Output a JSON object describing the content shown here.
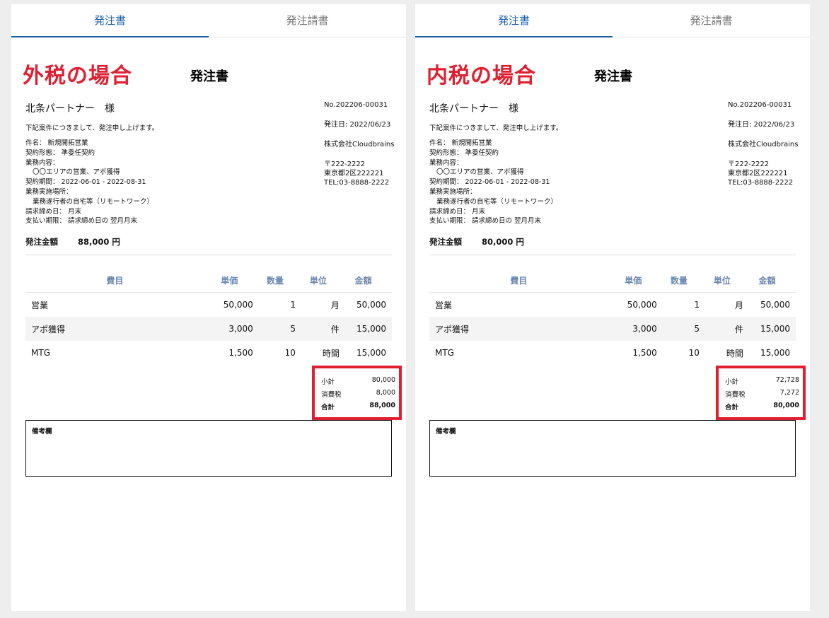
{
  "panels": [
    {
      "tabs": [
        {
          "label": "発注書",
          "active": true
        },
        {
          "label": "発注請書",
          "active": false
        }
      ],
      "tax_label": "外税の場合",
      "doc_title": "発注書",
      "client": "北条パートナー　様",
      "intro": "下記案件につきまして、発注申し上げます。",
      "details": [
        "件名： 新規開拓営業",
        "契約形態： 準委任契約",
        "業務内容：",
        "〇〇エリアの営業、アポ獲得",
        "契約期間： 2022-06-01 - 2022-08-31",
        "業務実施場所：",
        "業務遂行者の自宅等（リモートワーク）",
        "請求締め日： 月末",
        "支払い期限： 請求締め日の 翌月月末"
      ],
      "meta": {
        "no": "No.202206-00031",
        "date": "発注日: 2022/06/23",
        "company": "株式会社Cloudbrains",
        "zip": "〒222-2222",
        "address": "東京都2区222221",
        "tel": "TEL:03-8888-2222"
      },
      "amount_label": "発注金額",
      "amount_value": "88,000 円",
      "table": {
        "headers": [
          "費目",
          "単価",
          "数量",
          "単位",
          "金額"
        ],
        "rows": [
          [
            "営業",
            "50,000",
            "1",
            "月",
            "50,000"
          ],
          [
            "アポ獲得",
            "3,000",
            "5",
            "件",
            "15,000"
          ],
          [
            "MTG",
            "1,500",
            "10",
            "時間",
            "15,000"
          ]
        ]
      },
      "totals": [
        {
          "label": "小計",
          "value": "80,000"
        },
        {
          "label": "消費税",
          "value": "8,000"
        },
        {
          "label": "合計",
          "value": "88,000"
        }
      ],
      "notes_label": "備考欄"
    },
    {
      "tabs": [
        {
          "label": "発注書",
          "active": true
        },
        {
          "label": "発注請書",
          "active": false
        }
      ],
      "tax_label": "内税の場合",
      "doc_title": "発注書",
      "client": "北条パートナー　様",
      "intro": "下記案件につきまして、発注申し上げます。",
      "details": [
        "件名： 新規開拓営業",
        "契約形態： 準委任契約",
        "業務内容：",
        "〇〇エリアの営業、アポ獲得",
        "契約期間： 2022-06-01 - 2022-08-31",
        "業務実施場所：",
        "業務遂行者の自宅等（リモートワーク）",
        "請求締め日： 月末",
        "支払い期限： 請求締め日の 翌月月末"
      ],
      "meta": {
        "no": "No.202206-00031",
        "date": "発注日: 2022/06/23",
        "company": "株式会社Cloudbrains",
        "zip": "〒222-2222",
        "address": "東京都2区222221",
        "tel": "TEL:03-8888-2222"
      },
      "amount_label": "発注金額",
      "amount_value": "80,000 円",
      "table": {
        "headers": [
          "費目",
          "単価",
          "数量",
          "単位",
          "金額"
        ],
        "rows": [
          [
            "営業",
            "50,000",
            "1",
            "月",
            "50,000"
          ],
          [
            "アポ獲得",
            "3,000",
            "5",
            "件",
            "15,000"
          ],
          [
            "MTG",
            "1,500",
            "10",
            "時間",
            "15,000"
          ]
        ]
      },
      "totals": [
        {
          "label": "小計",
          "value": "72,728"
        },
        {
          "label": "消費税",
          "value": "7,272"
        },
        {
          "label": "合計",
          "value": "80,000"
        }
      ],
      "notes_label": "備考欄"
    }
  ],
  "colors": {
    "accent": "#1a5ea8",
    "highlight_red": "#e02030",
    "header_text": "#6a86b0"
  }
}
